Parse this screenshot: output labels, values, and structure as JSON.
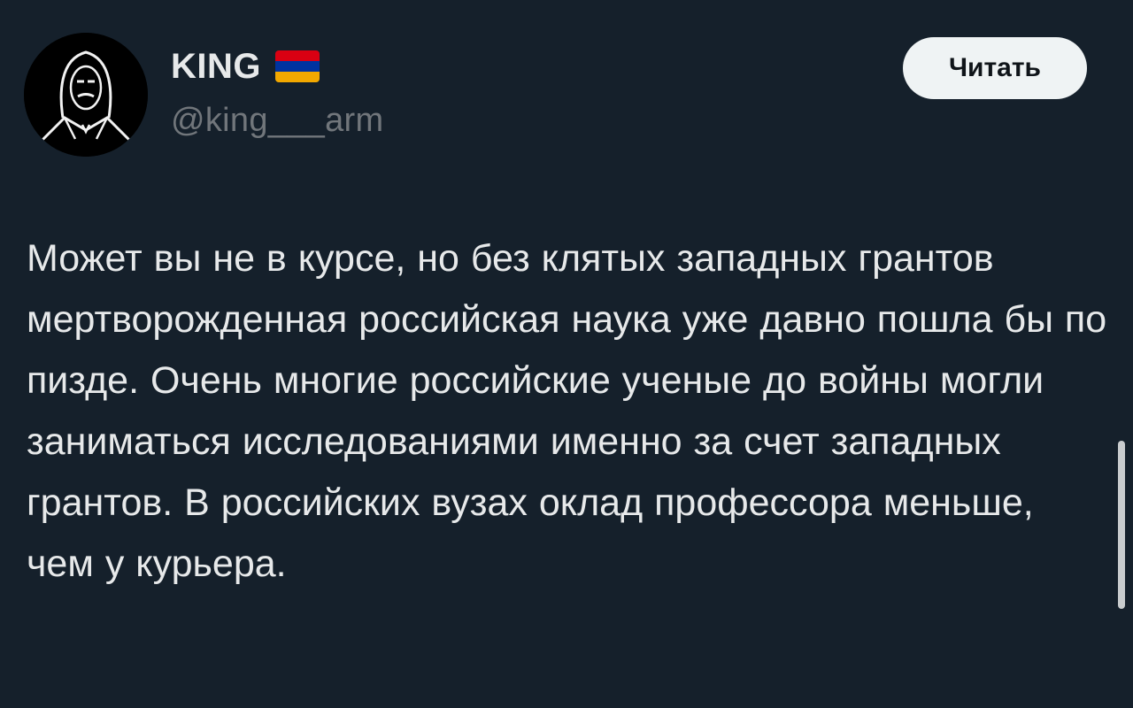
{
  "author": {
    "display_name": "KING",
    "handle": "@king___arm",
    "flag_icon": "armenia-flag-icon",
    "flag_colors": [
      "#d90012",
      "#0033a0",
      "#f2a800"
    ]
  },
  "follow_button": {
    "label": "Читать"
  },
  "tweet": {
    "text": "Может вы не в курсе, но без клятых западных грантов мертворожденная российская наука уже давно пошла бы по пизде. Очень многие российские ученые до войны могли заниматься исследованиями именно за счет западных грантов. В российских вузах оклад профессора меньше, чем у курьера."
  },
  "theme": {
    "background": "#15202b",
    "text_primary": "#e7e9ea",
    "text_secondary": "#71767b",
    "button_bg": "#eff3f4"
  }
}
